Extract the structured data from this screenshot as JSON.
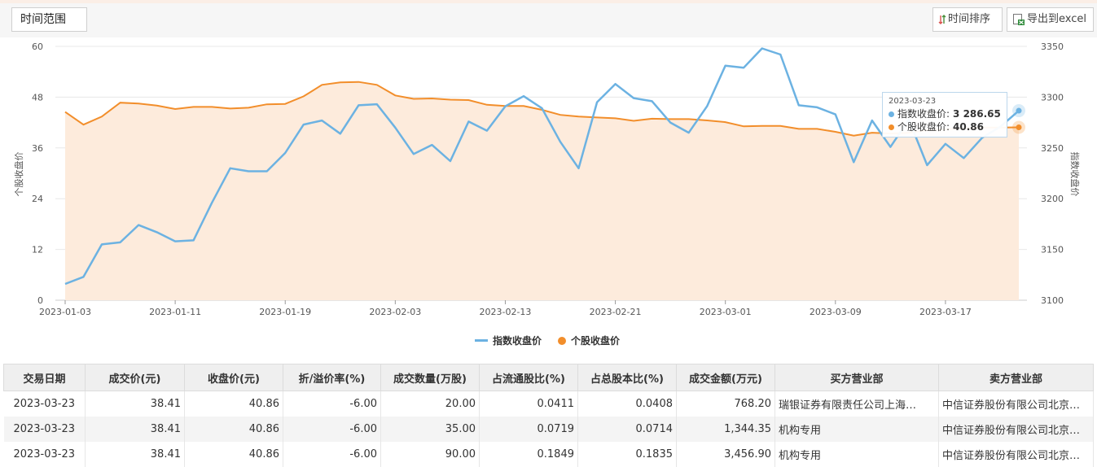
{
  "toolbar": {
    "time_range_label": "时间范围",
    "sort_label": "时间排序",
    "export_label": "导出到excel"
  },
  "chart_data": {
    "type": "line",
    "x": [
      "2023-01-03",
      "2023-01-04",
      "2023-01-05",
      "2023-01-06",
      "2023-01-09",
      "2023-01-10",
      "2023-01-11",
      "2023-01-12",
      "2023-01-13",
      "2023-01-16",
      "2023-01-17",
      "2023-01-18",
      "2023-01-19",
      "2023-01-20",
      "2023-01-30",
      "2023-01-31",
      "2023-02-01",
      "2023-02-02",
      "2023-02-03",
      "2023-02-06",
      "2023-02-07",
      "2023-02-08",
      "2023-02-09",
      "2023-02-10",
      "2023-02-13",
      "2023-02-14",
      "2023-02-15",
      "2023-02-16",
      "2023-02-17",
      "2023-02-20",
      "2023-02-21",
      "2023-02-22",
      "2023-02-23",
      "2023-02-24",
      "2023-02-27",
      "2023-02-28",
      "2023-03-01",
      "2023-03-02",
      "2023-03-03",
      "2023-03-06",
      "2023-03-07",
      "2023-03-08",
      "2023-03-09",
      "2023-03-10",
      "2023-03-13",
      "2023-03-14",
      "2023-03-15",
      "2023-03-16",
      "2023-03-17",
      "2023-03-20",
      "2023-03-21",
      "2023-03-22",
      "2023-03-23"
    ],
    "x_ticks": [
      "2023-01-03",
      "2023-01-11",
      "2023-01-19",
      "2023-02-03",
      "2023-02-13",
      "2023-02-21",
      "2023-03-01",
      "2023-03-09",
      "2023-03-17"
    ],
    "series": [
      {
        "name": "指数收盘价",
        "axis": "right",
        "color": "#6cb2e2",
        "values": [
          3116,
          3123,
          3155,
          3157,
          3174,
          3167,
          3158,
          3159,
          3196,
          3230,
          3227,
          3227,
          3245,
          3273,
          3277,
          3264,
          3292,
          3293,
          3270,
          3244,
          3253,
          3237,
          3276,
          3267,
          3291,
          3301,
          3289,
          3256,
          3230,
          3295,
          3313,
          3299,
          3296,
          3275,
          3265,
          3291,
          3331,
          3329,
          3348,
          3342,
          3292,
          3290,
          3283,
          3236,
          3277,
          3251,
          3278,
          3233,
          3254,
          3240,
          3260,
          3271,
          3286.65
        ]
      },
      {
        "name": "个股收盘价",
        "axis": "left",
        "color": "#f28e2b",
        "values": [
          44.5,
          41.5,
          43.4,
          46.7,
          46.5,
          46.0,
          45.2,
          45.7,
          45.7,
          45.3,
          45.5,
          46.3,
          46.4,
          48.2,
          50.9,
          51.5,
          51.6,
          50.9,
          48.4,
          47.6,
          47.7,
          47.4,
          47.3,
          46.2,
          45.9,
          45.9,
          45.0,
          43.8,
          43.4,
          43.2,
          43.0,
          42.4,
          42.9,
          42.8,
          42.8,
          42.5,
          42.1,
          41.1,
          41.2,
          41.2,
          40.5,
          40.5,
          39.8,
          38.9,
          39.6,
          39.4,
          39.6,
          40.2,
          40.4,
          40.6,
          40.8,
          40.8,
          40.86
        ]
      }
    ],
    "ylabel_left": "个股收盘价",
    "ylabel_right": "指数收盘价",
    "ylim_left": [
      0,
      60
    ],
    "yticks_left": [
      0,
      12,
      24,
      36,
      48,
      60
    ],
    "ylim_right": [
      3100,
      3350
    ],
    "yticks_right": [
      3100,
      3150,
      3200,
      3250,
      3300,
      3350
    ],
    "grid": true,
    "legend": "bottom-center",
    "area_fill_color": "#fdebdc"
  },
  "tooltip": {
    "date": "2023-03-23",
    "index_label": "指数收盘价:",
    "index_value": "3 286.65",
    "stock_label": "个股收盘价:",
    "stock_value": "40.86"
  },
  "table": {
    "headers": [
      "交易日期",
      "成交价(元)",
      "收盘价(元)",
      "折/溢价率(%)",
      "成交数量(万股)",
      "占流通股比(%)",
      "占总股本比(%)",
      "成交金额(万元)",
      "买方营业部",
      "卖方营业部"
    ],
    "rows": [
      [
        "2023-03-23",
        "38.41",
        "40.86",
        "-6.00",
        "20.00",
        "0.0411",
        "0.0408",
        "768.20",
        "瑞银证券有限责任公司上海…",
        "中信证券股份有限公司北京…"
      ],
      [
        "2023-03-23",
        "38.41",
        "40.86",
        "-6.00",
        "35.00",
        "0.0719",
        "0.0714",
        "1,344.35",
        "机构专用",
        "中信证券股份有限公司北京…"
      ],
      [
        "2023-03-23",
        "38.41",
        "40.86",
        "-6.00",
        "90.00",
        "0.1849",
        "0.1835",
        "3,456.90",
        "机构专用",
        "中信证券股份有限公司北京…"
      ]
    ]
  }
}
